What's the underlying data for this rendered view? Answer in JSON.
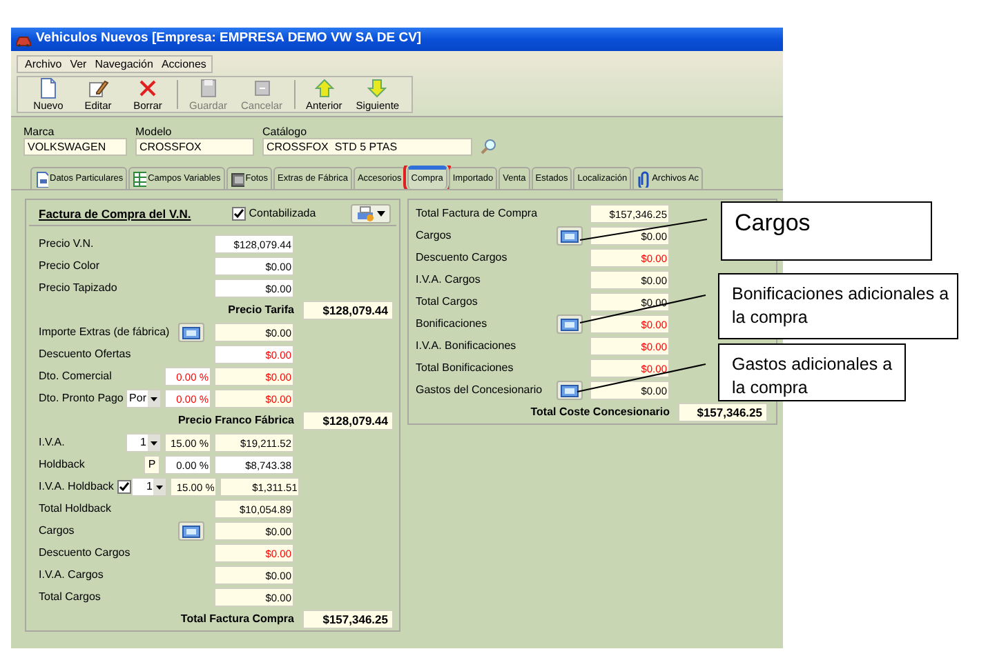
{
  "window": {
    "title": "Vehiculos Nuevos [Empresa: EMPRESA DEMO VW SA DE CV]"
  },
  "menu": [
    "Archivo",
    "Ver",
    "Navegación",
    "Acciones"
  ],
  "toolbar_groups": [
    {
      "buttons": [
        {
          "label": "Nuevo",
          "kind": "new",
          "disabled": false
        },
        {
          "label": "Editar",
          "kind": "edit",
          "disabled": false
        },
        {
          "label": "Borrar",
          "kind": "delete",
          "disabled": false
        }
      ]
    },
    {
      "buttons": [
        {
          "label": "Guardar",
          "kind": "save",
          "disabled": true
        },
        {
          "label": "Cancelar",
          "kind": "cancel",
          "disabled": true
        }
      ]
    },
    {
      "buttons": [
        {
          "label": "Anterior",
          "kind": "up",
          "disabled": false
        },
        {
          "label": "Siguiente",
          "kind": "down",
          "disabled": false
        }
      ]
    }
  ],
  "header_fields": [
    {
      "label": "Marca",
      "value": "VOLKSWAGEN"
    },
    {
      "label": "Modelo",
      "value": "CROSSFOX"
    },
    {
      "label": "Catálogo",
      "value": "CROSSFOX  STD 5 PTAS"
    }
  ],
  "tabs": [
    {
      "label": "Datos Particulares",
      "kind": "document",
      "selected": false,
      "highlighted": false
    },
    {
      "label": "Campos Variables",
      "kind": "grid",
      "selected": false,
      "highlighted": false
    },
    {
      "label": "Fotos",
      "kind": "photo",
      "selected": false,
      "highlighted": false
    },
    {
      "label": "Extras de Fábrica",
      "kind": "plain",
      "selected": false,
      "highlighted": false
    },
    {
      "label": "Accesorios",
      "kind": "plain",
      "selected": false,
      "highlighted": false
    },
    {
      "label": "Compra",
      "kind": "plain",
      "selected": true,
      "highlighted": true
    },
    {
      "label": "Importado",
      "kind": "plain",
      "selected": false,
      "highlighted": false
    },
    {
      "label": "Venta",
      "kind": "plain",
      "selected": false,
      "highlighted": false
    },
    {
      "label": "Estados",
      "kind": "plain",
      "selected": false,
      "highlighted": false
    },
    {
      "label": "Localización",
      "kind": "plain",
      "selected": false,
      "highlighted": false
    },
    {
      "label": "Archivos Ac",
      "kind": "clip",
      "selected": false,
      "highlighted": false
    }
  ],
  "invoice": {
    "title": "Factura de Compra del V.N.",
    "posted": {
      "label": "Contabilizada",
      "checked": true
    },
    "rows": [
      {
        "kind": "field",
        "label": "Precio V.N.",
        "value": {
          "text": "$128,079.44",
          "editable": true,
          "negative": false
        }
      },
      {
        "kind": "field",
        "label": "Precio Color",
        "value": {
          "text": "$0.00",
          "editable": true,
          "negative": false
        }
      },
      {
        "kind": "field",
        "label": "Precio Tapizado",
        "value": {
          "text": "$0.00",
          "editable": true,
          "negative": false
        }
      },
      {
        "kind": "total",
        "label": "Precio Tarifa",
        "value": "$128,079.44"
      },
      {
        "kind": "field",
        "label": "Importe Extras (de fábrica)",
        "button": true,
        "value": {
          "text": "$0.00",
          "editable": false,
          "negative": false
        }
      },
      {
        "kind": "field",
        "label": "Descuento Ofertas",
        "value": {
          "text": "$0.00",
          "editable": true,
          "negative": true
        }
      },
      {
        "kind": "field",
        "label": "Dto. Comercial",
        "percent": {
          "text": "0.00 %",
          "editable": true,
          "negative": true
        },
        "value": {
          "text": "$0.00",
          "editable": false,
          "negative": true
        }
      },
      {
        "kind": "field",
        "label": "Dto. Pronto Pago",
        "select": "Por",
        "percent": {
          "text": "0.00 %",
          "editable": true,
          "negative": true
        },
        "value": {
          "text": "$0.00",
          "editable": false,
          "negative": true
        }
      },
      {
        "kind": "total",
        "label": "Precio Franco Fábrica",
        "value": "$128,079.44"
      },
      {
        "kind": "field",
        "label": "I.V.A.",
        "select": "1",
        "percent": {
          "text": "15.00 %",
          "editable": false,
          "negative": false
        },
        "value": {
          "text": "$19,211.52",
          "editable": false,
          "negative": false
        }
      },
      {
        "kind": "field",
        "label": "Holdback",
        "flag": "P",
        "percent": {
          "text": "0.00 %",
          "editable": true,
          "negative": false
        },
        "value": {
          "text": "$8,743.38",
          "editable": true,
          "negative": false
        }
      },
      {
        "kind": "field",
        "label": "I.V.A. Holdback",
        "checked": true,
        "select": "1",
        "percent": {
          "text": "15.00 %",
          "editable": false,
          "negative": false
        },
        "value": {
          "text": "$1,311.51",
          "editable": false,
          "negative": false
        }
      },
      {
        "kind": "field",
        "label": "Total Holdback",
        "value": {
          "text": "$10,054.89",
          "editable": false,
          "negative": false
        }
      },
      {
        "kind": "field",
        "label": "Cargos",
        "button": true,
        "value": {
          "text": "$0.00",
          "editable": false,
          "negative": false
        }
      },
      {
        "kind": "field",
        "label": "Descuento Cargos",
        "value": {
          "text": "$0.00",
          "editable": false,
          "negative": true
        }
      },
      {
        "kind": "field",
        "label": "I.V.A. Cargos",
        "value": {
          "text": "$0.00",
          "editable": false,
          "negative": false
        }
      },
      {
        "kind": "field",
        "label": "Total Cargos",
        "value": {
          "text": "$0.00",
          "editable": false,
          "negative": false
        }
      },
      {
        "kind": "total",
        "label": "Total Factura Compra",
        "value": "$157,346.25"
      }
    ]
  },
  "dealer_cost": {
    "rows": [
      {
        "kind": "field",
        "label": "Total Factura de Compra",
        "value": {
          "text": "$157,346.25",
          "editable": false,
          "negative": false
        }
      },
      {
        "kind": "field",
        "label": "Cargos",
        "button": true,
        "value": {
          "text": "$0.00",
          "editable": false,
          "negative": false
        }
      },
      {
        "kind": "field",
        "label": "Descuento Cargos",
        "value": {
          "text": "$0.00",
          "editable": false,
          "negative": true
        }
      },
      {
        "kind": "field",
        "label": "I.V.A. Cargos",
        "value": {
          "text": "$0.00",
          "editable": false,
          "negative": false
        }
      },
      {
        "kind": "field",
        "label": "Total Cargos",
        "value": {
          "text": "$0.00",
          "editable": false,
          "negative": false
        }
      },
      {
        "kind": "field",
        "label": "Bonificaciones",
        "button": true,
        "value": {
          "text": "$0.00",
          "editable": false,
          "negative": true
        }
      },
      {
        "kind": "field",
        "label": "I.V.A. Bonificaciones",
        "value": {
          "text": "$0.00",
          "editable": false,
          "negative": true
        }
      },
      {
        "kind": "field",
        "label": "Total Bonificaciones",
        "value": {
          "text": "$0.00",
          "editable": false,
          "negative": true
        }
      },
      {
        "kind": "field",
        "label": "Gastos del Concesionario",
        "button": true,
        "value": {
          "text": "$0.00",
          "editable": false,
          "negative": false
        }
      },
      {
        "kind": "total",
        "label": "Total Coste Concesionario",
        "value": "$157,346.25"
      }
    ]
  },
  "callouts": [
    {
      "kind": "heading",
      "text": "Cargos"
    },
    {
      "kind": "note",
      "text": "Bonificaciones adicionales a la compra"
    },
    {
      "kind": "note",
      "text": "Gastos adicionales a la compra"
    }
  ]
}
